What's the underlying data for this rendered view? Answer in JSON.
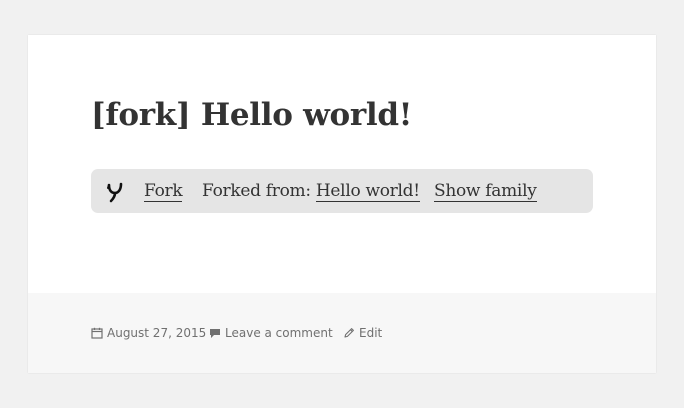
{
  "post": {
    "title": "[fork] Hello world!"
  },
  "fork_bar": {
    "fork_label": "Fork",
    "forked_from_prefix": "Forked from: ",
    "forked_from_title": "Hello world!",
    "show_family_label": "Show family",
    "icon": "fork-icon"
  },
  "footer": {
    "date": "August 27, 2015",
    "comment_label": "Leave a comment",
    "edit_label": "Edit",
    "icons": [
      "calendar-icon",
      "comment-icon",
      "pencil-icon"
    ]
  },
  "colors": {
    "page_background": "#f1f1f1",
    "card_background": "#ffffff",
    "footer_background": "#f7f7f7",
    "fork_bar_background": "#e5e5e5",
    "text": "#333333",
    "meta_text": "#707070"
  }
}
